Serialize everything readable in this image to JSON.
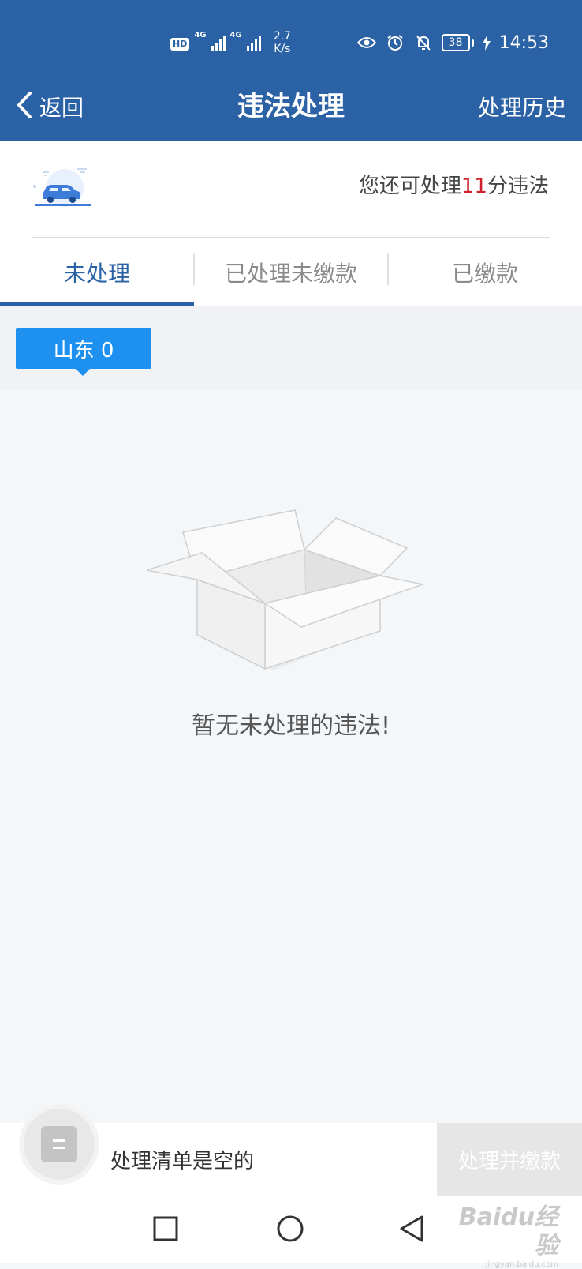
{
  "status_bar": {
    "hd_label": "HD",
    "net1": "4G",
    "net2": "4G",
    "speed_value": "2.7",
    "speed_unit": "K/s",
    "battery": "38",
    "time": "14:53"
  },
  "header": {
    "back_label": "返回",
    "title": "违法处理",
    "history_label": "处理历史",
    "background_color": "#2b62a6"
  },
  "summary": {
    "points_prefix": "您还可处理",
    "points_value": "11",
    "points_suffix": "分违法",
    "points_color": "#d0202e"
  },
  "tabs": [
    {
      "label": "未处理",
      "active": true
    },
    {
      "label": "已处理未缴款",
      "active": false
    },
    {
      "label": "已缴款",
      "active": false
    }
  ],
  "region": {
    "label": "山东 0",
    "color": "#1e90f0"
  },
  "empty_state": {
    "icon": "empty-box-icon",
    "message": "暂无未处理的违法!"
  },
  "action_bar": {
    "list_icon": "list-icon",
    "cart_label": "处理清单是空的",
    "pay_button": "处理并缴款"
  },
  "system_nav": {
    "recent_icon": "square-icon",
    "home_icon": "circle-icon",
    "back_icon": "triangle-back-icon"
  },
  "watermark": {
    "main": "Baidu经验",
    "sub": "jingyan.baidu.com"
  }
}
